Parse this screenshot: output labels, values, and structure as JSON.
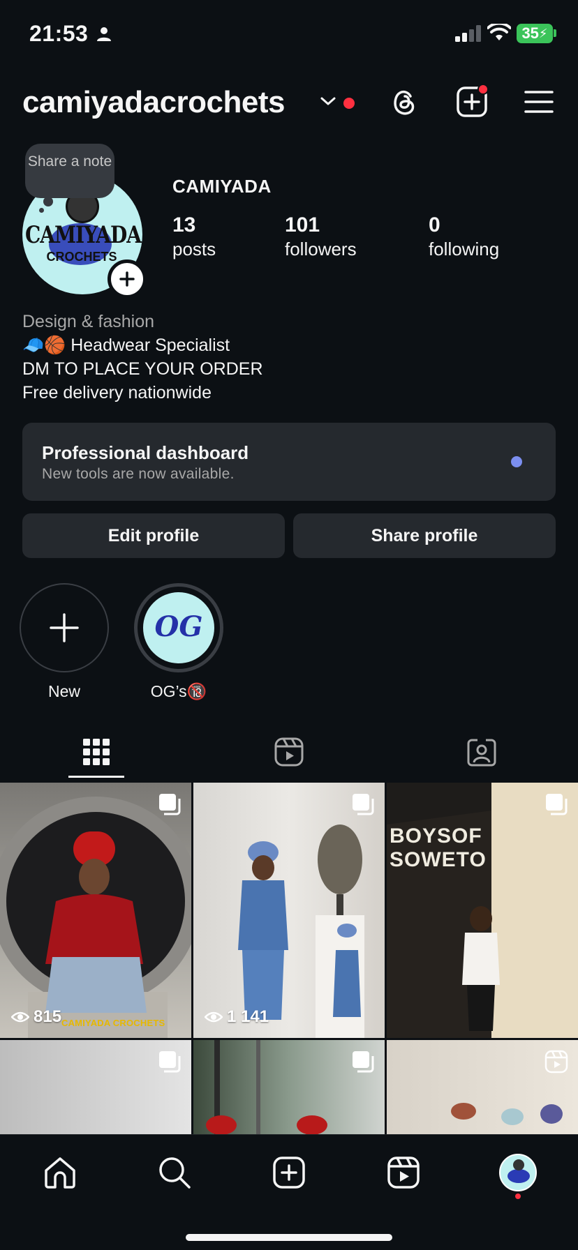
{
  "status_bar": {
    "time": "21:53",
    "battery": "35"
  },
  "header": {
    "username": "camiyadacrochets"
  },
  "profile": {
    "note": "Share a note",
    "display_name": "CAMIYADA",
    "avatar_text": "CAMIYADA",
    "avatar_sub": "CROCHETS",
    "stats": [
      {
        "value": "13",
        "label": "posts"
      },
      {
        "value": "101",
        "label": "followers"
      },
      {
        "value": "0",
        "label": "following"
      }
    ],
    "bio": {
      "category": "Design & fashion",
      "line1": "🧢🏀 Headwear Specialist",
      "line2": "DM TO PLACE YOUR ORDER",
      "line3": "Free delivery nationwide"
    }
  },
  "dashboard": {
    "title": "Professional dashboard",
    "subtitle": "New tools are now available."
  },
  "buttons": {
    "edit": "Edit profile",
    "share": "Share profile"
  },
  "highlights": [
    {
      "label": "New"
    },
    {
      "label": "OG’s🔞",
      "cover_text": "OG"
    }
  ],
  "grid": {
    "posts": [
      {
        "views": "815",
        "watermark": "CAMIYADA CROCHETS"
      },
      {
        "views": "1 141"
      },
      {
        "sign_text": "BOYSOFSOWETO"
      }
    ]
  },
  "colors": {
    "background": "#0c1014",
    "surface": "#25292e",
    "accent_red": "#ff3040",
    "dot_blue": "#7c8ff0",
    "battery_green": "#3bc45a"
  }
}
